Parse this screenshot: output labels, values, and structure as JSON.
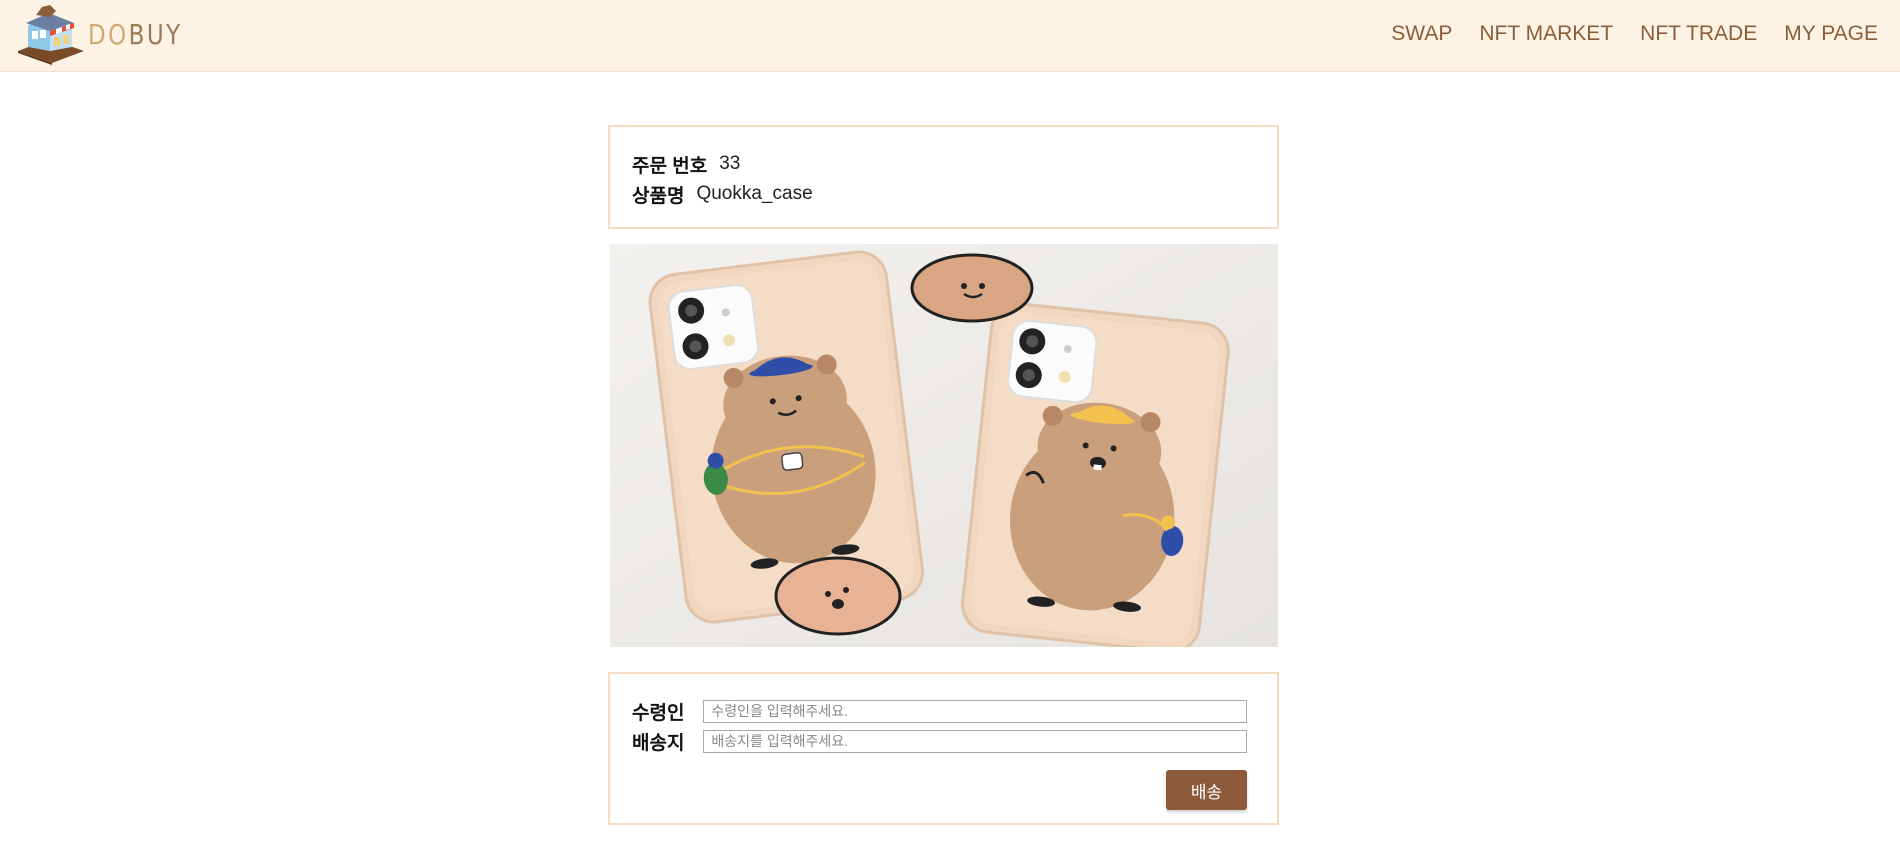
{
  "header": {
    "logo_text_do": "DO",
    "logo_text_buy": "BUY",
    "nav": [
      "SWAP",
      "NFT MARKET",
      "NFT TRADE",
      "MY PAGE"
    ]
  },
  "order": {
    "order_number_label": "주문 번호",
    "order_number": "33",
    "product_name_label": "상품명",
    "product_name": "Quokka_case"
  },
  "shipping": {
    "recipient_label": "수령인",
    "recipient_placeholder": "수령인을 입력해주세요.",
    "address_label": "배송지",
    "address_placeholder": "배송지를 입력해주세요.",
    "ship_button": "배송"
  },
  "colors": {
    "header_bg": "#fdf3e4",
    "nav_text": "#8a5e3b",
    "card_border": "#f6dcc0",
    "button_bg": "#8c5a3b"
  }
}
